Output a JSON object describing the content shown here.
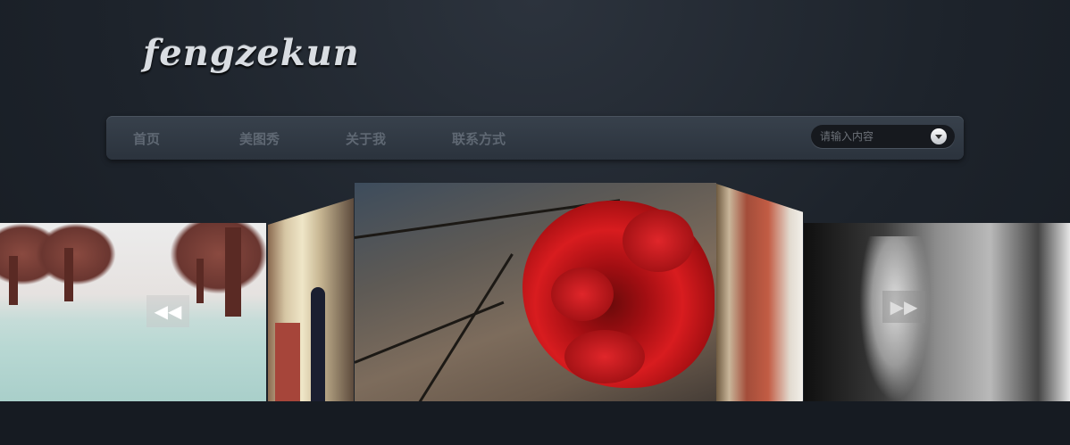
{
  "logo": {
    "text": "fengzekun"
  },
  "nav": {
    "items": [
      {
        "label": "首页"
      },
      {
        "label": "美图秀"
      },
      {
        "label": "关于我"
      },
      {
        "label": "联系方式"
      }
    ]
  },
  "search": {
    "placeholder": "请输入内容",
    "value": ""
  },
  "carousel": {
    "prev_icon": "rewind-icon",
    "next_icon": "fast-forward-icon",
    "prev_glyph": "◀◀",
    "next_glyph": "▶▶",
    "slides": [
      {
        "subject": "snowy-trees-photo"
      },
      {
        "subject": "alley-figure-photo"
      },
      {
        "subject": "red-rose-photo"
      },
      {
        "subject": "brick-street-photo"
      },
      {
        "subject": "tunnel-dancer-photo"
      }
    ]
  },
  "colors": {
    "background": "#1d232b",
    "nav": "#333b45",
    "nav_text": "#5f6873",
    "accent": "#d81c1f"
  }
}
